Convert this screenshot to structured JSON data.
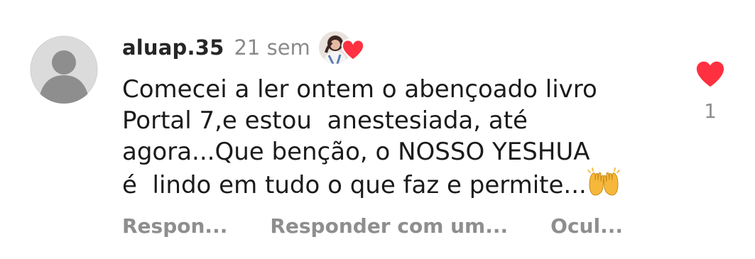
{
  "comment": {
    "username": "aluap.35",
    "time": "21 sem",
    "text": "Comecei a ler ontem o abençoado livro\nPortal 7,e estou  anestesiada, até\nagora...Que benção, o NOSSO YESHUA\né  lindo em tudo o que faz e permite...",
    "emoji": "raising-hands-icon",
    "author_liked": true
  },
  "actions": {
    "reply_label": "Respon...",
    "reply_with_label": "Responder com um...",
    "hide_label": "Ocul..."
  },
  "like": {
    "icon": "heart-icon",
    "count": "1",
    "color": "#ff3040"
  },
  "colors": {
    "text": "#1b1b1b",
    "muted": "#8e8e8e",
    "heart": "#ff3040",
    "avatar_bg": "#dbdbdb",
    "avatar_fg": "#8e8e8e"
  }
}
